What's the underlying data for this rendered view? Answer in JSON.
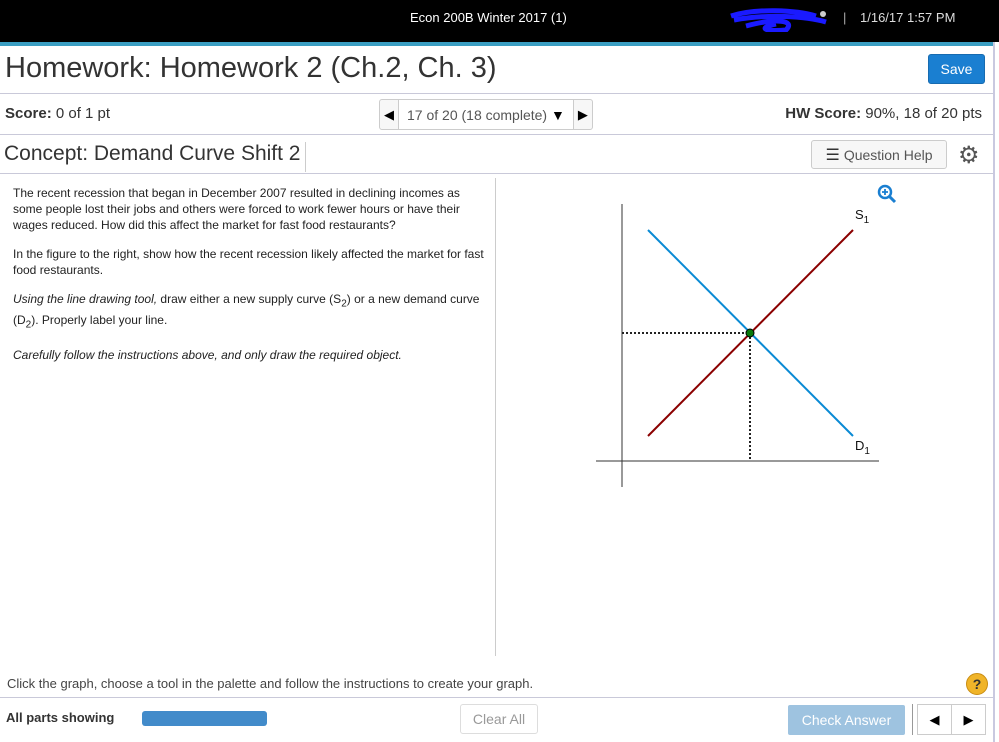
{
  "topbar": {
    "course": "Econ 200B Winter 2017 (1)",
    "separator": "|",
    "datetime": "1/16/17 1:57 PM"
  },
  "header": {
    "title": "Homework: Homework 2 (Ch.2, Ch. 3)",
    "save_label": "Save"
  },
  "scorebar": {
    "score_label": "Score:",
    "score_value": "0 of 1 pt",
    "question_nav": "17 of 20 (18 complete)",
    "hw_score_label": "HW Score:",
    "hw_score_value": "90%, 18 of 20 pts"
  },
  "question": {
    "concept": "Concept: Demand Curve Shift 2",
    "help_label": "Question Help",
    "paragraphs": [
      "The recent recession that began in December 2007 resulted in declining incomes as some people lost their jobs and others were forced to work fewer hours or have their wages reduced.  How did this affect the market for fast food restaurants?",
      "In the figure to the right, show how the recent recession likely affected the market for fast food restaurants."
    ],
    "instruction_a": "Using the line drawing tool,",
    "instruction_b": " draw either a new supply curve (S",
    "instruction_c": ") or a new demand curve (D",
    "instruction_d": "). Properly label your line.",
    "sub2": "2",
    "careful": "Carefully follow the instructions above, and only draw the required object."
  },
  "graph": {
    "supply_label": "S",
    "demand_label": "D",
    "subscript": "1",
    "supply_color": "#8b0000",
    "demand_color": "#0a8ad4",
    "equilibrium_color": "#0a7a0a"
  },
  "footer": {
    "hint": "Click the graph, choose a tool in the palette and follow the instructions to create your graph.",
    "help_icon": "?",
    "parts_label": "All parts showing",
    "progress_percent": 100,
    "clear_label": "Clear All",
    "check_label": "Check Answer"
  }
}
